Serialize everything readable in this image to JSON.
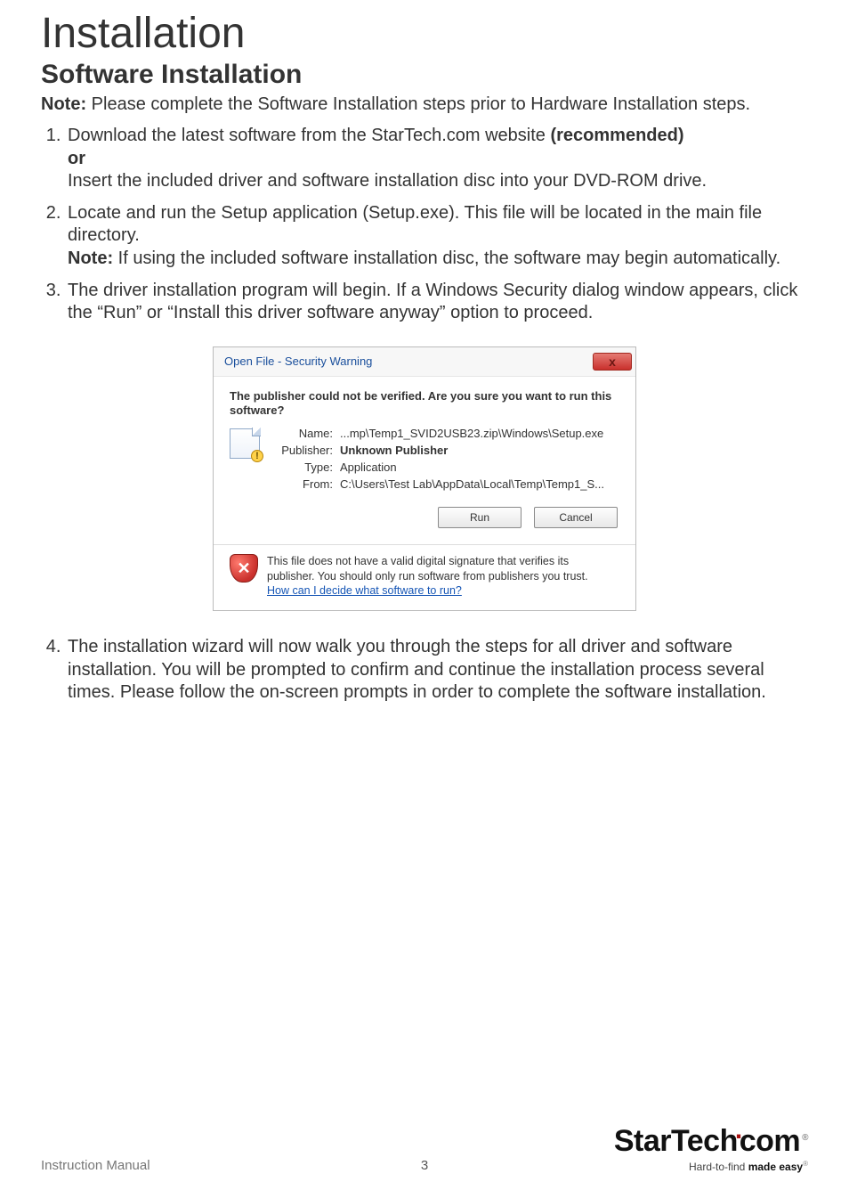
{
  "headings": {
    "main": "Installation",
    "sub": "Software Installation"
  },
  "note_label": "Note:",
  "intro_note_rest": " Please complete the Software Installation steps prior to Hardware Installation steps.",
  "steps": {
    "s1_a": "Download the latest software from the StarTech.com website ",
    "s1_bold1": "(recommended)",
    "s1_or": "or",
    "s1_b": "Insert the included driver and software installation disc into your DVD-ROM drive.",
    "s2_a": "Locate and run the Setup application (Setup.exe). This file will be located in the main file directory.",
    "s2_note_rest": " If using the included software installation disc, the software may begin automatically.",
    "s3": "The driver installation program will begin. If a Windows Security dialog window appears, click the “Run” or “Install this driver software anyway” option to proceed.",
    "s4": "The installation wizard will now walk you through the steps for all driver and software installation. You will be prompted to confirm and continue the installation process several times. Please follow the on-screen prompts in order to complete the software installation."
  },
  "dialog": {
    "title": "Open File - Security Warning",
    "question": "The publisher could not be verified.  Are you sure you want to run this software?",
    "labels": {
      "name": "Name:",
      "publisher": "Publisher:",
      "type": "Type:",
      "from": "From:"
    },
    "values": {
      "name": "...mp\\Temp1_SVID2USB23.zip\\Windows\\Setup.exe",
      "publisher": "Unknown Publisher",
      "type": "Application",
      "from": "C:\\Users\\Test Lab\\AppData\\Local\\Temp\\Temp1_S..."
    },
    "buttons": {
      "run": "Run",
      "cancel": "Cancel"
    },
    "footer_line1": "This file does not have a valid digital signature that verifies its publisher.  You should only run software from publishers you trust.",
    "footer_link": "How can I decide what software to run?"
  },
  "footer": {
    "doc_label": "Instruction Manual",
    "page_number": "3",
    "brand_main": "StarTech",
    "brand_dot_com": "com",
    "brand_tag_a": "Hard-to-find ",
    "brand_tag_b": "made easy"
  }
}
